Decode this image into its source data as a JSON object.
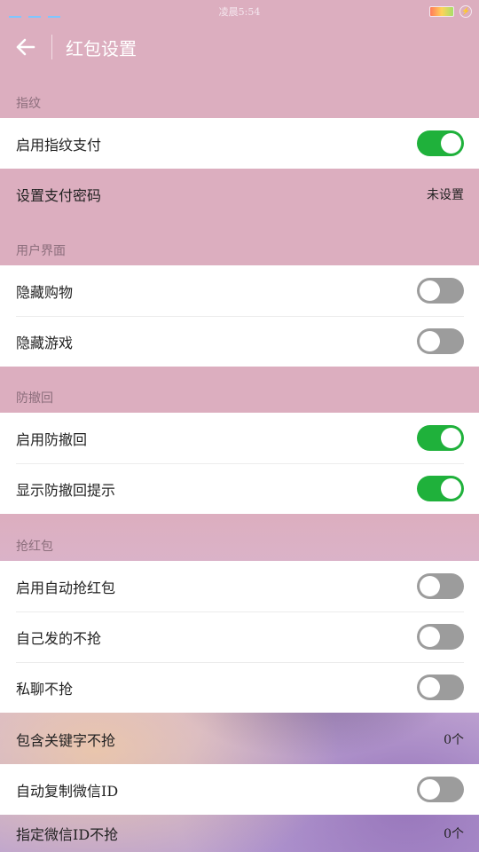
{
  "status": {
    "time": "凌晨5:54",
    "charge_icon": "charging-icon"
  },
  "header": {
    "title": "红包设置",
    "back_icon": "arrow-left-icon"
  },
  "sections": {
    "fingerprint": "指纹",
    "ui": "用户界面",
    "anti_recall": "防撤回",
    "red_packet": "抢红包"
  },
  "rows": {
    "enable_fingerprint": {
      "label": "启用指纹支付",
      "on": true
    },
    "set_password": {
      "label": "设置支付密码",
      "value": "未设置"
    },
    "hide_shopping": {
      "label": "隐藏购物",
      "on": false
    },
    "hide_games": {
      "label": "隐藏游戏",
      "on": false
    },
    "enable_anti_recall": {
      "label": "启用防撤回",
      "on": true
    },
    "show_anti_recall_tip": {
      "label": "显示防撤回提示",
      "on": true
    },
    "enable_auto_grab": {
      "label": "启用自动抢红包",
      "on": false
    },
    "skip_own": {
      "label": "自己发的不抢",
      "on": false
    },
    "skip_private": {
      "label": "私聊不抢",
      "on": false
    },
    "keyword_skip": {
      "label": "包含关键字不抢",
      "value": "0个"
    },
    "auto_copy_id": {
      "label": "自动复制微信ID",
      "on": false
    },
    "specified_id_skip": {
      "label": "指定微信ID不抢",
      "value": "0个"
    }
  },
  "colors": {
    "toggle_on": "#1fb13b",
    "toggle_off": "#9c9c9c",
    "background": "#dcaebf"
  }
}
